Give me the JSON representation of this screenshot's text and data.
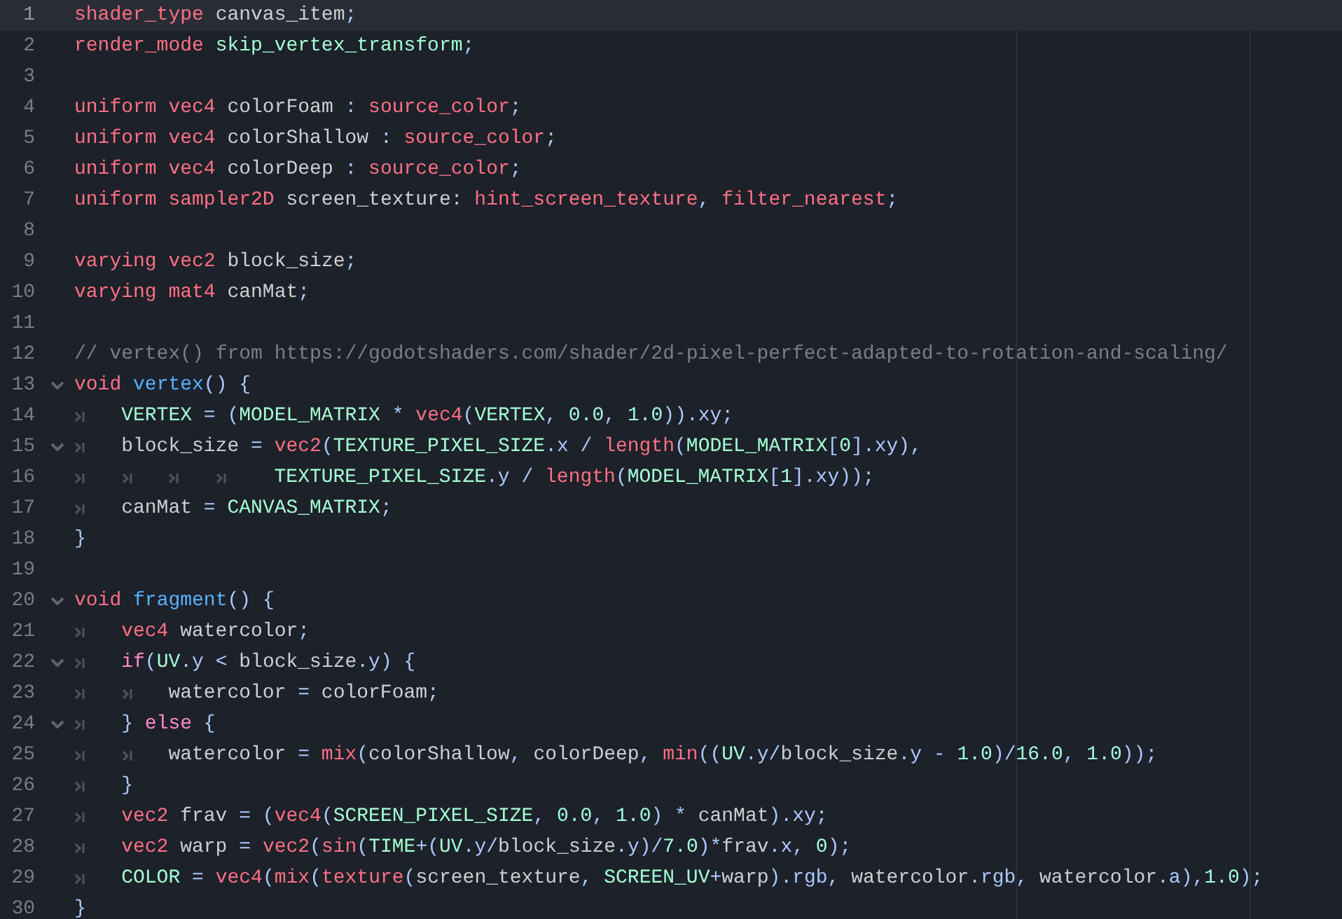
{
  "editor": {
    "lines": [
      {
        "number": "1",
        "current": true,
        "fold": false,
        "tokens": [
          {
            "kind": "kw",
            "text": "shader_type"
          },
          {
            "kind": "id",
            "text": " canvas_item"
          },
          {
            "kind": "sym",
            "text": ";"
          }
        ]
      },
      {
        "number": "2",
        "current": false,
        "fold": false,
        "tokens": [
          {
            "kind": "kw",
            "text": "render_mode"
          },
          {
            "kind": "cst",
            "text": " skip_vertex_transform"
          },
          {
            "kind": "sym",
            "text": ";"
          }
        ]
      },
      {
        "number": "3",
        "current": false,
        "fold": false
      },
      {
        "number": "4",
        "current": false,
        "fold": false,
        "tokens": [
          {
            "kind": "kw",
            "text": "uniform vec4"
          },
          {
            "kind": "id",
            "text": " colorFoam "
          },
          {
            "kind": "sym",
            "text": ":"
          },
          {
            "kind": "kw",
            "text": " source_color"
          },
          {
            "kind": "sym",
            "text": ";"
          }
        ]
      },
      {
        "number": "5",
        "current": false,
        "fold": false,
        "tokens": [
          {
            "kind": "kw",
            "text": "uniform vec4"
          },
          {
            "kind": "id",
            "text": " colorShallow "
          },
          {
            "kind": "sym",
            "text": ":"
          },
          {
            "kind": "kw",
            "text": " source_color"
          },
          {
            "kind": "sym",
            "text": ";"
          }
        ]
      },
      {
        "number": "6",
        "current": false,
        "fold": false,
        "tokens": [
          {
            "kind": "kw",
            "text": "uniform vec4"
          },
          {
            "kind": "id",
            "text": " colorDeep "
          },
          {
            "kind": "sym",
            "text": ":"
          },
          {
            "kind": "kw",
            "text": " source_color"
          },
          {
            "kind": "sym",
            "text": ";"
          }
        ]
      },
      {
        "number": "7",
        "current": false,
        "fold": false,
        "tokens": [
          {
            "kind": "kw",
            "text": "uniform sampler2D"
          },
          {
            "kind": "id",
            "text": " screen_texture"
          },
          {
            "kind": "sym",
            "text": ":"
          },
          {
            "kind": "kw",
            "text": " hint_screen_texture"
          },
          {
            "kind": "sym",
            "text": ","
          },
          {
            "kind": "kw",
            "text": " filter_nearest"
          },
          {
            "kind": "sym",
            "text": ";"
          }
        ]
      },
      {
        "number": "8",
        "current": false,
        "fold": false
      },
      {
        "number": "9",
        "current": false,
        "fold": false,
        "tokens": [
          {
            "kind": "kw",
            "text": "varying vec2"
          },
          {
            "kind": "id",
            "text": " block_size"
          },
          {
            "kind": "sym",
            "text": ";"
          }
        ]
      },
      {
        "number": "10",
        "current": false,
        "fold": false,
        "tokens": [
          {
            "kind": "kw",
            "text": "varying mat4"
          },
          {
            "kind": "id",
            "text": " canMat"
          },
          {
            "kind": "sym",
            "text": ";"
          }
        ]
      },
      {
        "number": "11",
        "current": false,
        "fold": false
      },
      {
        "number": "12",
        "current": false,
        "fold": false,
        "tokens": [
          {
            "kind": "cmt",
            "text": "// vertex() from https://godotshaders.com/shader/2d-pixel-perfect-adapted-to-rotation-and-scaling/"
          }
        ]
      },
      {
        "number": "13",
        "current": false,
        "fold": true,
        "tokens": [
          {
            "kind": "kw",
            "text": "void"
          },
          {
            "kind": "fn",
            "text": " vertex"
          },
          {
            "kind": "sym",
            "text": "() {"
          }
        ]
      },
      {
        "number": "14",
        "current": false,
        "fold": false,
        "indent": [
          {
            "kind": "tab"
          }
        ],
        "tokens": [
          {
            "kind": "cst",
            "text": "VERTEX"
          },
          {
            "kind": "sym",
            "text": " = ("
          },
          {
            "kind": "cst",
            "text": "MODEL_MATRIX"
          },
          {
            "kind": "sym",
            "text": " * "
          },
          {
            "kind": "kw",
            "text": "vec4"
          },
          {
            "kind": "sym",
            "text": "("
          },
          {
            "kind": "cst",
            "text": "VERTEX"
          },
          {
            "kind": "sym",
            "text": ", "
          },
          {
            "kind": "num",
            "text": "0.0"
          },
          {
            "kind": "sym",
            "text": ", "
          },
          {
            "kind": "num",
            "text": "1.0"
          },
          {
            "kind": "sym",
            "text": ")).xy;"
          }
        ]
      },
      {
        "number": "15",
        "current": false,
        "fold": true,
        "indent": [
          {
            "kind": "tab"
          }
        ],
        "tokens": [
          {
            "kind": "id",
            "text": "block_size"
          },
          {
            "kind": "sym",
            "text": " = "
          },
          {
            "kind": "kw",
            "text": "vec2"
          },
          {
            "kind": "sym",
            "text": "("
          },
          {
            "kind": "cst",
            "text": "TEXTURE_PIXEL_SIZE"
          },
          {
            "kind": "sym",
            "text": ".x / "
          },
          {
            "kind": "kw",
            "text": "length"
          },
          {
            "kind": "sym",
            "text": "("
          },
          {
            "kind": "cst",
            "text": "MODEL_MATRIX"
          },
          {
            "kind": "sym",
            "text": "["
          },
          {
            "kind": "num",
            "text": "0"
          },
          {
            "kind": "sym",
            "text": "].xy),"
          }
        ]
      },
      {
        "number": "16",
        "current": false,
        "fold": false,
        "indent": [
          {
            "kind": "tab"
          },
          {
            "kind": "tab"
          },
          {
            "kind": "tab"
          },
          {
            "kind": "tab"
          }
        ],
        "tokens": [
          {
            "kind": "cst",
            "text": " TEXTURE_PIXEL_SIZE"
          },
          {
            "kind": "sym",
            "text": ".y / "
          },
          {
            "kind": "kw",
            "text": "length"
          },
          {
            "kind": "sym",
            "text": "("
          },
          {
            "kind": "cst",
            "text": "MODEL_MATRIX"
          },
          {
            "kind": "sym",
            "text": "["
          },
          {
            "kind": "num",
            "text": "1"
          },
          {
            "kind": "sym",
            "text": "].xy));"
          }
        ]
      },
      {
        "number": "17",
        "current": false,
        "fold": false,
        "indent": [
          {
            "kind": "tab"
          }
        ],
        "tokens": [
          {
            "kind": "id",
            "text": "canMat"
          },
          {
            "kind": "sym",
            "text": " = "
          },
          {
            "kind": "cst",
            "text": "CANVAS_MATRIX"
          },
          {
            "kind": "sym",
            "text": ";"
          }
        ]
      },
      {
        "number": "18",
        "current": false,
        "fold": false,
        "tokens": [
          {
            "kind": "sym",
            "text": "}"
          }
        ]
      },
      {
        "number": "19",
        "current": false,
        "fold": false
      },
      {
        "number": "20",
        "current": false,
        "fold": true,
        "tokens": [
          {
            "kind": "kw",
            "text": "void"
          },
          {
            "kind": "fn",
            "text": " fragment"
          },
          {
            "kind": "sym",
            "text": "() {"
          }
        ]
      },
      {
        "number": "21",
        "current": false,
        "fold": false,
        "indent": [
          {
            "kind": "tab"
          }
        ],
        "tokens": [
          {
            "kind": "kw",
            "text": "vec4"
          },
          {
            "kind": "id",
            "text": " watercolor"
          },
          {
            "kind": "sym",
            "text": ";"
          }
        ]
      },
      {
        "number": "22",
        "current": false,
        "fold": true,
        "indent": [
          {
            "kind": "tab"
          }
        ],
        "tokens": [
          {
            "kind": "ctl",
            "text": "if"
          },
          {
            "kind": "sym",
            "text": "("
          },
          {
            "kind": "cst",
            "text": "UV"
          },
          {
            "kind": "sym",
            "text": ".y < "
          },
          {
            "kind": "id",
            "text": "block_size"
          },
          {
            "kind": "sym",
            "text": ".y) {"
          }
        ]
      },
      {
        "number": "23",
        "current": false,
        "fold": false,
        "indent": [
          {
            "kind": "tab"
          },
          {
            "kind": "tab"
          }
        ],
        "tokens": [
          {
            "kind": "id",
            "text": "watercolor"
          },
          {
            "kind": "sym",
            "text": " = "
          },
          {
            "kind": "id",
            "text": "colorFoam"
          },
          {
            "kind": "sym",
            "text": ";"
          }
        ]
      },
      {
        "number": "24",
        "current": false,
        "fold": true,
        "indent": [
          {
            "kind": "tab"
          }
        ],
        "tokens": [
          {
            "kind": "sym",
            "text": "} "
          },
          {
            "kind": "ctl",
            "text": "else"
          },
          {
            "kind": "sym",
            "text": " {"
          }
        ]
      },
      {
        "number": "25",
        "current": false,
        "fold": false,
        "indent": [
          {
            "kind": "tab"
          },
          {
            "kind": "tab"
          }
        ],
        "tokens": [
          {
            "kind": "id",
            "text": "watercolor"
          },
          {
            "kind": "sym",
            "text": " = "
          },
          {
            "kind": "kw",
            "text": "mix"
          },
          {
            "kind": "sym",
            "text": "("
          },
          {
            "kind": "id",
            "text": "colorShallow"
          },
          {
            "kind": "sym",
            "text": ", "
          },
          {
            "kind": "id",
            "text": "colorDeep"
          },
          {
            "kind": "sym",
            "text": ", "
          },
          {
            "kind": "kw",
            "text": "min"
          },
          {
            "kind": "sym",
            "text": "(("
          },
          {
            "kind": "cst",
            "text": "UV"
          },
          {
            "kind": "sym",
            "text": ".y/"
          },
          {
            "kind": "id",
            "text": "block_size"
          },
          {
            "kind": "sym",
            "text": ".y - "
          },
          {
            "kind": "num",
            "text": "1.0"
          },
          {
            "kind": "sym",
            "text": ")/"
          },
          {
            "kind": "num",
            "text": "16.0"
          },
          {
            "kind": "sym",
            "text": ", "
          },
          {
            "kind": "num",
            "text": "1.0"
          },
          {
            "kind": "sym",
            "text": "));"
          }
        ]
      },
      {
        "number": "26",
        "current": false,
        "fold": false,
        "indent": [
          {
            "kind": "tab"
          }
        ],
        "tokens": [
          {
            "kind": "sym",
            "text": "}"
          }
        ]
      },
      {
        "number": "27",
        "current": false,
        "fold": false,
        "indent": [
          {
            "kind": "tab"
          }
        ],
        "tokens": [
          {
            "kind": "kw",
            "text": "vec2"
          },
          {
            "kind": "id",
            "text": " frav"
          },
          {
            "kind": "sym",
            "text": " = ("
          },
          {
            "kind": "kw",
            "text": "vec4"
          },
          {
            "kind": "sym",
            "text": "("
          },
          {
            "kind": "cst",
            "text": "SCREEN_PIXEL_SIZE"
          },
          {
            "kind": "sym",
            "text": ", "
          },
          {
            "kind": "num",
            "text": "0.0"
          },
          {
            "kind": "sym",
            "text": ", "
          },
          {
            "kind": "num",
            "text": "1.0"
          },
          {
            "kind": "sym",
            "text": ") * "
          },
          {
            "kind": "id",
            "text": "canMat"
          },
          {
            "kind": "sym",
            "text": ").xy;"
          }
        ]
      },
      {
        "number": "28",
        "current": false,
        "fold": false,
        "indent": [
          {
            "kind": "tab"
          }
        ],
        "tokens": [
          {
            "kind": "kw",
            "text": "vec2"
          },
          {
            "kind": "id",
            "text": " warp"
          },
          {
            "kind": "sym",
            "text": " = "
          },
          {
            "kind": "kw",
            "text": "vec2"
          },
          {
            "kind": "sym",
            "text": "("
          },
          {
            "kind": "kw",
            "text": "sin"
          },
          {
            "kind": "sym",
            "text": "("
          },
          {
            "kind": "cst",
            "text": "TIME"
          },
          {
            "kind": "sym",
            "text": "+("
          },
          {
            "kind": "cst",
            "text": "UV"
          },
          {
            "kind": "sym",
            "text": ".y/"
          },
          {
            "kind": "id",
            "text": "block_size"
          },
          {
            "kind": "sym",
            "text": ".y)/"
          },
          {
            "kind": "num",
            "text": "7.0"
          },
          {
            "kind": "sym",
            "text": ")*"
          },
          {
            "kind": "id",
            "text": "frav"
          },
          {
            "kind": "sym",
            "text": ".x, "
          },
          {
            "kind": "num",
            "text": "0"
          },
          {
            "kind": "sym",
            "text": ");"
          }
        ]
      },
      {
        "number": "29",
        "current": false,
        "fold": false,
        "indent": [
          {
            "kind": "tab"
          }
        ],
        "tokens": [
          {
            "kind": "cst",
            "text": "COLOR"
          },
          {
            "kind": "sym",
            "text": " = "
          },
          {
            "kind": "kw",
            "text": "vec4"
          },
          {
            "kind": "sym",
            "text": "("
          },
          {
            "kind": "kw",
            "text": "mix"
          },
          {
            "kind": "sym",
            "text": "("
          },
          {
            "kind": "kw",
            "text": "texture"
          },
          {
            "kind": "sym",
            "text": "("
          },
          {
            "kind": "id",
            "text": "screen_texture"
          },
          {
            "kind": "sym",
            "text": ", "
          },
          {
            "kind": "cst",
            "text": "SCREEN_UV"
          },
          {
            "kind": "sym",
            "text": "+"
          },
          {
            "kind": "id",
            "text": "warp"
          },
          {
            "kind": "sym",
            "text": ").rgb, "
          },
          {
            "kind": "id",
            "text": "watercolor"
          },
          {
            "kind": "sym",
            "text": ".rgb, "
          },
          {
            "kind": "id",
            "text": "watercolor"
          },
          {
            "kind": "sym",
            "text": ".a),"
          },
          {
            "kind": "num",
            "text": "1.0"
          },
          {
            "kind": "sym",
            "text": ");"
          }
        ]
      },
      {
        "number": "30",
        "current": false,
        "fold": false,
        "tokens": [
          {
            "kind": "sym",
            "text": "}"
          }
        ]
      }
    ]
  }
}
